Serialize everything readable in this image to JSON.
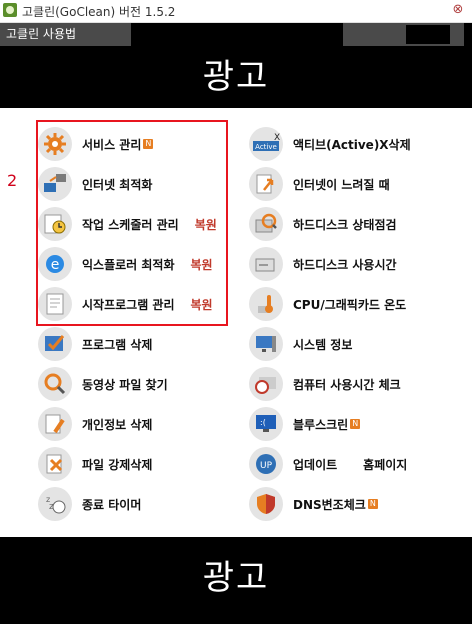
{
  "window": {
    "title": "고클린(GoClean) 버전 1.5.2"
  },
  "menubar": {
    "help_label": "고클린 사용법"
  },
  "ads": {
    "top_label": "광고",
    "bottom_label": "광고"
  },
  "annotation": {
    "marker": "2"
  },
  "badge_letter": "N",
  "left_items": [
    {
      "label": "서비스 관리",
      "badge": true,
      "restore": "",
      "icon": "gear-icon"
    },
    {
      "label": "인터넷 최적화",
      "badge": false,
      "restore": "",
      "icon": "network-icon"
    },
    {
      "label": "작업 스케줄러 관리",
      "badge": false,
      "restore": "복원",
      "icon": "scheduler-icon"
    },
    {
      "label": "익스플로러 최적화",
      "badge": false,
      "restore": "복원",
      "icon": "ie-icon"
    },
    {
      "label": "시작프로그램 관리",
      "badge": false,
      "restore": "복원",
      "icon": "startup-icon"
    },
    {
      "label": "프로그램 삭제",
      "badge": false,
      "restore": "",
      "icon": "uninstall-icon"
    },
    {
      "label": "동영상 파일 찾기",
      "badge": false,
      "restore": "",
      "icon": "video-search-icon"
    },
    {
      "label": "개인정보 삭제",
      "badge": false,
      "restore": "",
      "icon": "privacy-icon"
    },
    {
      "label": "파일 강제삭제",
      "badge": false,
      "restore": "",
      "icon": "force-delete-icon"
    },
    {
      "label": "종료 타이머",
      "badge": false,
      "restore": "",
      "icon": "sleep-timer-icon"
    }
  ],
  "right_items": [
    {
      "label": "액티브(Active)X삭제",
      "badge": false,
      "extra": "",
      "icon": "activex-icon"
    },
    {
      "label": "인터넷이 느려질 때",
      "badge": false,
      "extra": "",
      "icon": "slow-internet-icon"
    },
    {
      "label": "하드디스크 상태점검",
      "badge": false,
      "extra": "",
      "icon": "disk-check-icon"
    },
    {
      "label": "하드디스크 사용시간",
      "badge": false,
      "extra": "",
      "icon": "disk-time-icon"
    },
    {
      "label": "CPU/그래픽카드 온도",
      "badge": false,
      "extra": "",
      "icon": "temperature-icon"
    },
    {
      "label": "시스템 정보",
      "badge": false,
      "extra": "",
      "icon": "system-info-icon"
    },
    {
      "label": "컴퓨터 사용시간 체크",
      "badge": false,
      "extra": "",
      "icon": "pc-time-icon"
    },
    {
      "label": "블루스크린",
      "badge": true,
      "extra": "",
      "icon": "bluescreen-icon"
    },
    {
      "label": "업데이트",
      "badge": false,
      "extra": "홈페이지",
      "icon": "update-icon"
    },
    {
      "label": "DNS변조체크",
      "badge": true,
      "extra": "",
      "icon": "dns-shield-icon"
    }
  ]
}
